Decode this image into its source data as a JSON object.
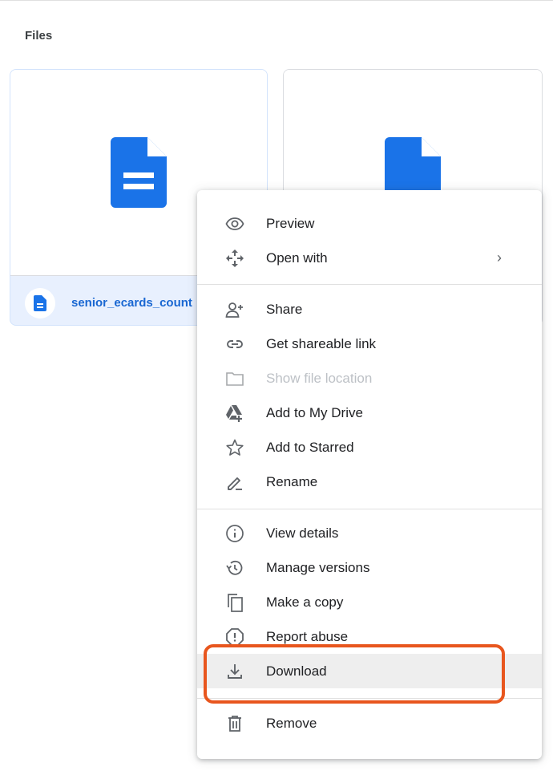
{
  "section": {
    "title": "Files"
  },
  "cards": [
    {
      "name": "senior_ecards_count"
    },
    {
      "name": ""
    }
  ],
  "menu": {
    "items": [
      {
        "label": "Preview",
        "icon": "eye-icon"
      },
      {
        "label": "Open with",
        "icon": "move-arrows-icon",
        "has_submenu": true
      },
      {
        "label": "Share",
        "icon": "person-add-icon"
      },
      {
        "label": "Get shareable link",
        "icon": "link-icon"
      },
      {
        "label": "Show file location",
        "icon": "folder-icon",
        "disabled": true
      },
      {
        "label": "Add to My Drive",
        "icon": "drive-add-icon"
      },
      {
        "label": "Add to Starred",
        "icon": "star-icon"
      },
      {
        "label": "Rename",
        "icon": "pencil-icon"
      },
      {
        "label": "View details",
        "icon": "info-icon"
      },
      {
        "label": "Manage versions",
        "icon": "history-icon"
      },
      {
        "label": "Make a copy",
        "icon": "copy-icon"
      },
      {
        "label": "Report abuse",
        "icon": "report-icon"
      },
      {
        "label": "Download",
        "icon": "download-icon",
        "highlighted": true
      },
      {
        "label": "Remove",
        "icon": "trash-icon"
      }
    ],
    "submenu_chevron": "›"
  },
  "colors": {
    "doc_blue": "#1a73e8",
    "selected_card": "#e8f0fe",
    "callout": "#e8561e",
    "highlight": "#eeeeee"
  }
}
